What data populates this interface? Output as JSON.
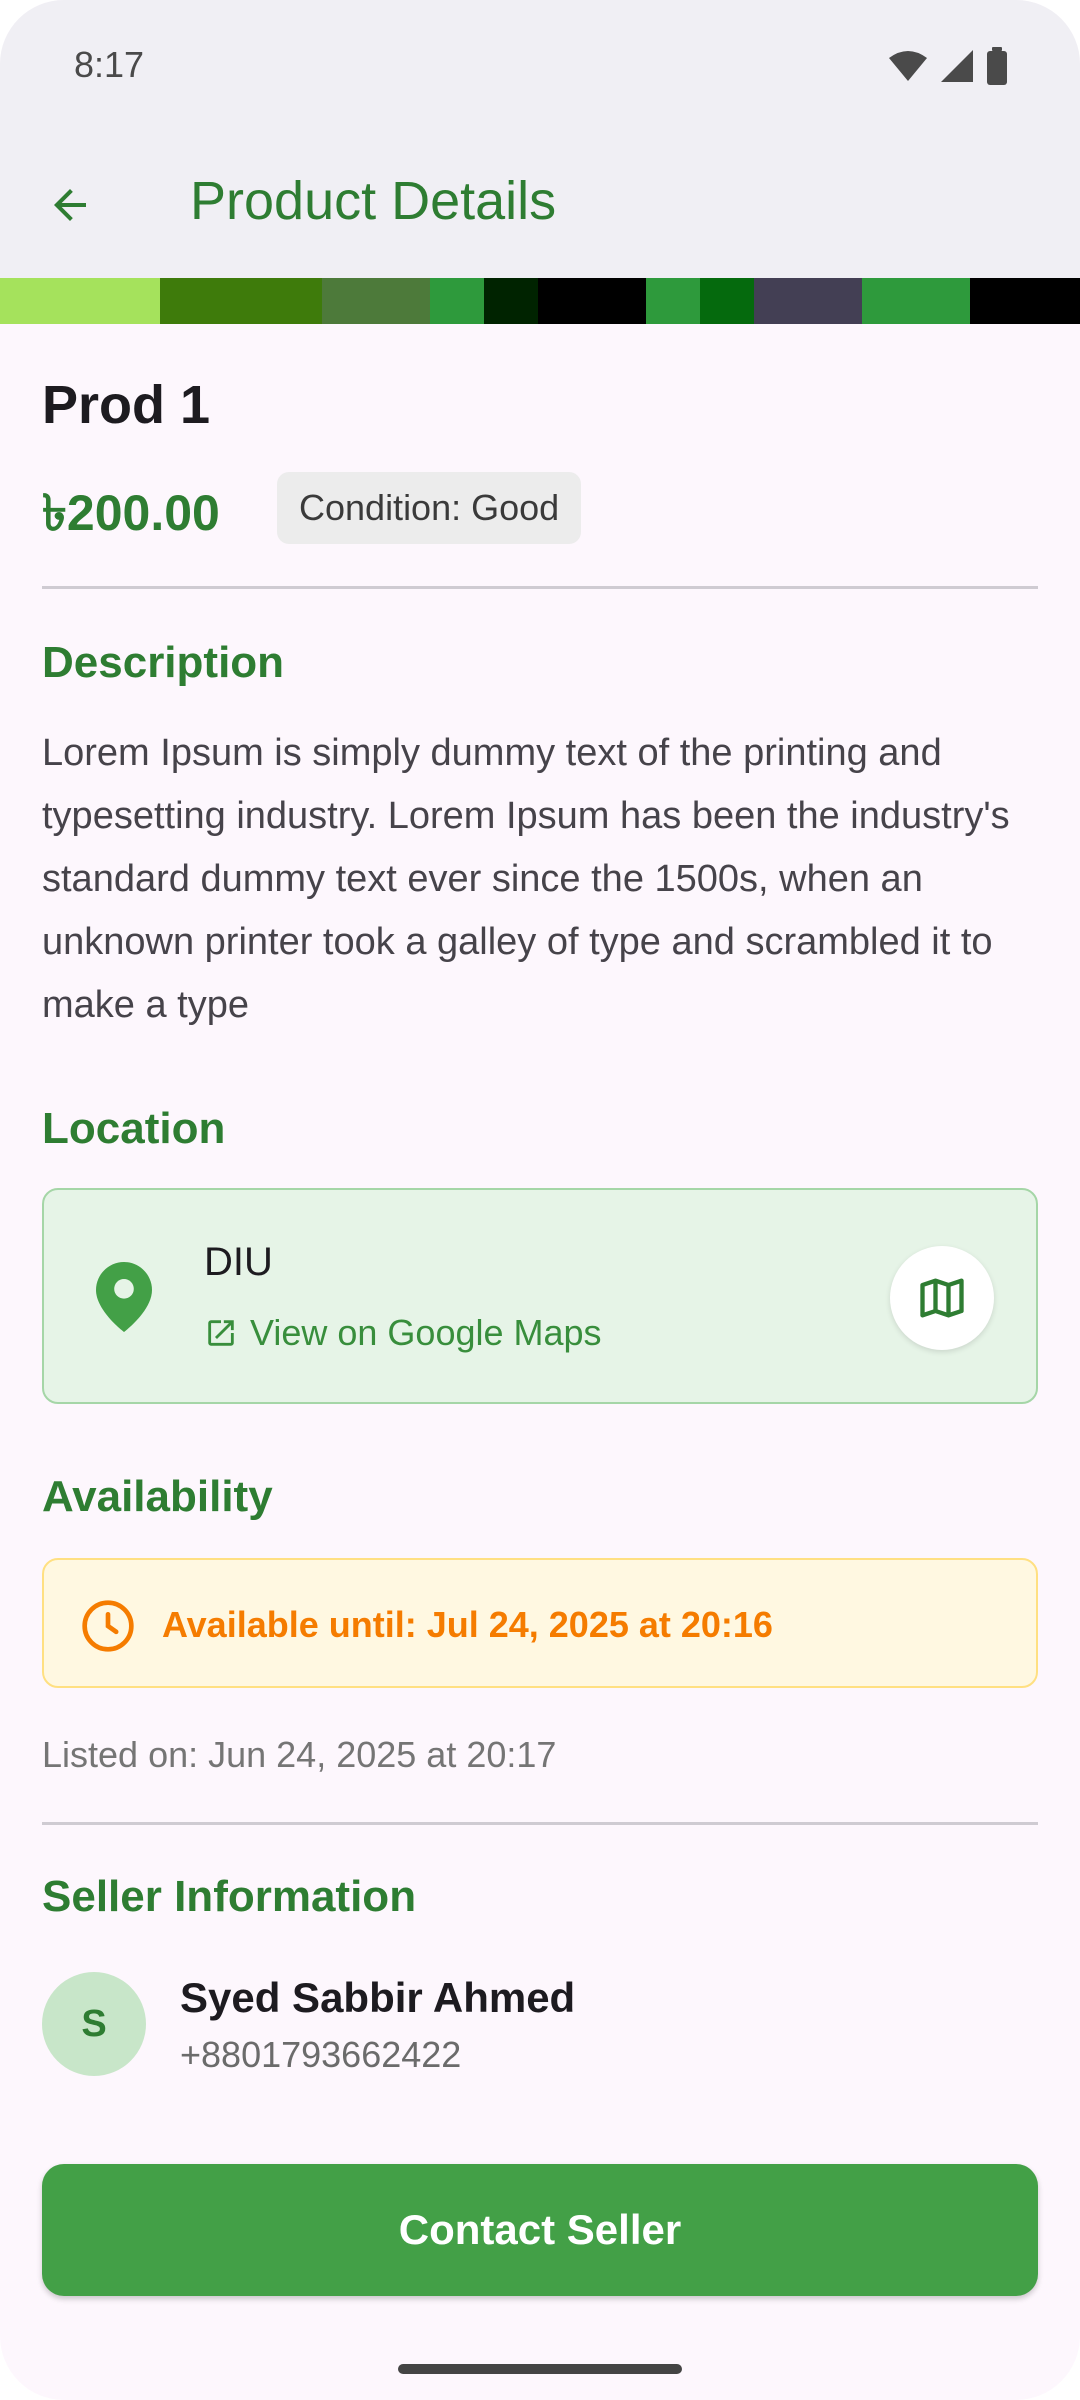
{
  "status_bar": {
    "time": "8:17",
    "icons": [
      "wifi-icon",
      "signal-icon",
      "battery-icon"
    ]
  },
  "app_bar": {
    "title": "Product Details",
    "back_icon": "arrow-back-icon"
  },
  "image_strip": {
    "colors": [
      "#a5e25c",
      "#3e7b0b",
      "#4d7a3a",
      "#2e9a3c",
      "#002300",
      "#000000",
      "#2e9a3c",
      "#056a0d",
      "#433f54",
      "#2e9a3c",
      "#000000"
    ]
  },
  "product": {
    "title": "Prod 1",
    "price": "৳200.00",
    "condition": "Condition: Good"
  },
  "description": {
    "heading": "Description",
    "text": "Lorem Ipsum is simply dummy text of the printing and typesetting industry. Lorem Ipsum has been the industry's standard dummy text ever since the 1500s, when an unknown printer took a galley of type and scrambled it to make a type"
  },
  "location": {
    "heading": "Location",
    "name": "DIU",
    "maps_link": "View on Google Maps",
    "pin_icon": "location-pin-icon",
    "link_icon": "open-in-new-icon",
    "map_button_icon": "map-icon"
  },
  "availability": {
    "heading": "Availability",
    "text": "Available until: Jul 24, 2025 at 20:16",
    "icon": "clock-icon"
  },
  "listed_on": "Listed on: Jun 24, 2025 at 20:17",
  "seller": {
    "heading": "Seller Information",
    "initial": "S",
    "name": "Syed Sabbir Ahmed",
    "phone": "+8801793662422"
  },
  "contact_button": "Contact Seller",
  "colors": {
    "primary": "#2e7d32",
    "button": "#43a047",
    "location_bg": "#e6f4e7",
    "availability_bg": "#fff8e1",
    "availability_text": "#f57c00"
  }
}
